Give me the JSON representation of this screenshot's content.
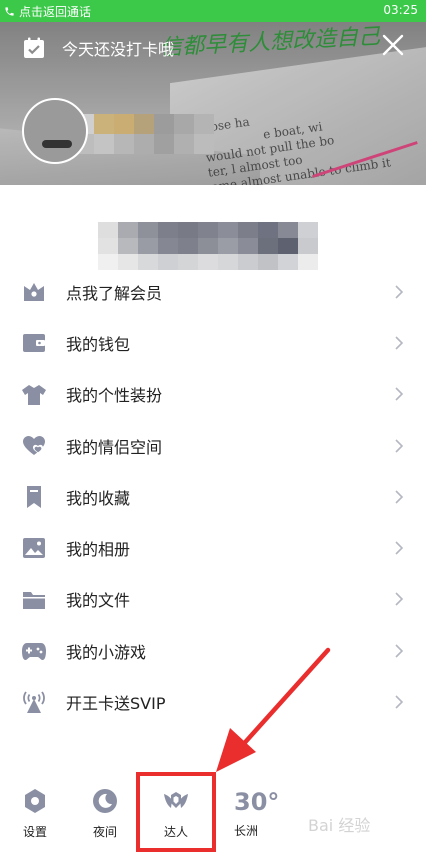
{
  "status_bar": {
    "call_text": "点击返回通话",
    "time": "03:25"
  },
  "header": {
    "checkin_text": "今天还没打卡哦",
    "background_text_lines": [
      "Rose ha",
      "e boat, wi",
      "would not pull the bo",
      "ter, l      almost too",
      "become   almost unable to climb it"
    ],
    "background_script": "信都早有人想改造自己"
  },
  "menu": {
    "items": [
      {
        "label": "点我了解会员",
        "icon": "vip-crown-icon"
      },
      {
        "label": "我的钱包",
        "icon": "wallet-icon"
      },
      {
        "label": "我的个性装扮",
        "icon": "tshirt-icon"
      },
      {
        "label": "我的情侣空间",
        "icon": "couple-heart-icon"
      },
      {
        "label": "我的收藏",
        "icon": "bookmark-icon"
      },
      {
        "label": "我的相册",
        "icon": "photo-album-icon"
      },
      {
        "label": "我的文件",
        "icon": "folder-icon"
      },
      {
        "label": "我的小游戏",
        "icon": "gamepad-icon"
      },
      {
        "label": "开王卡送SVIP",
        "icon": "signal-tower-icon"
      }
    ]
  },
  "bottom_bar": {
    "settings_label": "设置",
    "night_label": "夜间",
    "expert_label": "达人",
    "temperature": "30°",
    "city": "长洲"
  },
  "watermark_text": "Bai 经验",
  "colors": {
    "status_bar": "#3cc94a",
    "icon_gray": "#8a8fa3",
    "annotation_red": "#ea2d2d"
  }
}
